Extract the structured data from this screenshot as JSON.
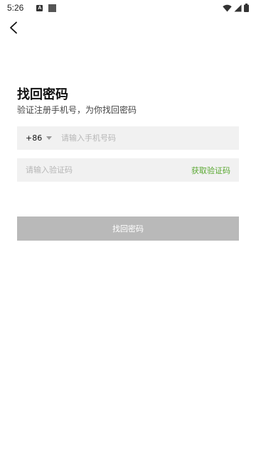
{
  "status_bar": {
    "time": "5:26",
    "notification_a": "A"
  },
  "page": {
    "title": "找回密码",
    "subtitle": "验证注册手机号，为你找回密码"
  },
  "phone_field": {
    "country_code": "+86",
    "placeholder": "请输入手机号码",
    "value": ""
  },
  "code_field": {
    "placeholder": "请输入验证码",
    "value": "",
    "get_code_label": "获取验证码"
  },
  "submit_button": {
    "label": "找回密码"
  },
  "colors": {
    "accent_green": "#5aa832",
    "button_disabled": "#b9b9b9",
    "field_background": "#f1f1f1"
  },
  "icons": [
    "back-arrow-icon",
    "wifi-icon",
    "signal-icon",
    "battery-icon",
    "dropdown-caret-icon"
  ]
}
